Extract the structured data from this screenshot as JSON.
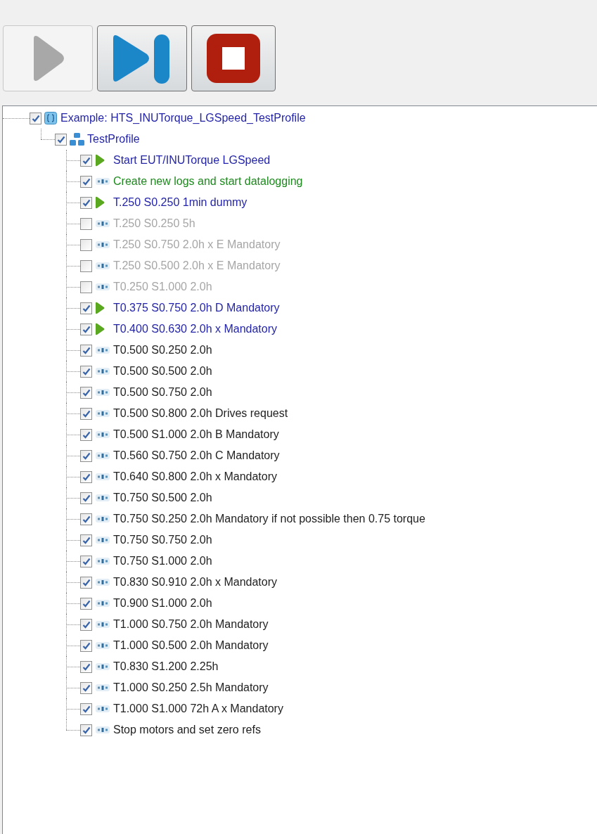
{
  "toolbar": {
    "buttons": [
      {
        "kind": "play",
        "disabled": true
      },
      {
        "kind": "step",
        "disabled": false
      },
      {
        "kind": "stop",
        "disabled": false
      }
    ]
  },
  "tree": {
    "label": "Example: HTS_INUTorque_LGSpeed_TestProfile",
    "kind": "script",
    "checked": true,
    "color": "#2424a8",
    "children": [
      {
        "label": "TestProfile",
        "kind": "profile",
        "checked": true,
        "color": "#2424a8",
        "children": [
          {
            "label": "Start EUT/INUTorque LGSpeed",
            "kind": "run",
            "checked": true,
            "color": "#2424a8"
          },
          {
            "label": "Create new logs and start datalogging",
            "kind": "step",
            "checked": true,
            "color": "#1d8a1d"
          },
          {
            "label": "T.250 S0.250 1min dummy",
            "kind": "run",
            "checked": true,
            "color": "#2424a8"
          },
          {
            "label": "T.250 S0.250 5h",
            "kind": "step",
            "checked": false,
            "color": "#a6a6a6"
          },
          {
            "label": "T.250 S0.750 2.0h x E Mandatory",
            "kind": "step",
            "checked": false,
            "color": "#a6a6a6"
          },
          {
            "label": "T.250 S0.500 2.0h x E Mandatory",
            "kind": "step",
            "checked": false,
            "color": "#a6a6a6"
          },
          {
            "label": "T0.250 S1.000 2.0h",
            "kind": "step",
            "checked": false,
            "color": "#a6a6a6"
          },
          {
            "label": "T0.375 S0.750 2.0h D Mandatory",
            "kind": "run",
            "checked": true,
            "color": "#2424a8"
          },
          {
            "label": "T0.400 S0.630 2.0h x Mandatory",
            "kind": "run",
            "checked": true,
            "color": "#2424a8"
          },
          {
            "label": "T0.500 S0.250 2.0h",
            "kind": "step",
            "checked": true,
            "color": "#222222"
          },
          {
            "label": "T0.500 S0.500 2.0h",
            "kind": "step",
            "checked": true,
            "color": "#222222"
          },
          {
            "label": "T0.500 S0.750 2.0h",
            "kind": "step",
            "checked": true,
            "color": "#222222"
          },
          {
            "label": "T0.500 S0.800 2.0h Drives request",
            "kind": "step",
            "checked": true,
            "color": "#222222"
          },
          {
            "label": "T0.500 S1.000 2.0h B Mandatory",
            "kind": "step",
            "checked": true,
            "color": "#222222"
          },
          {
            "label": "T0.560 S0.750 2.0h C Mandatory",
            "kind": "step",
            "checked": true,
            "color": "#222222"
          },
          {
            "label": "T0.640 S0.800 2.0h x Mandatory",
            "kind": "step",
            "checked": true,
            "color": "#222222"
          },
          {
            "label": "T0.750 S0.500 2.0h",
            "kind": "step",
            "checked": true,
            "color": "#222222"
          },
          {
            "label": "T0.750 S0.250 2.0h Mandatory if not possible then 0.75 torque",
            "kind": "step",
            "checked": true,
            "color": "#222222"
          },
          {
            "label": "T0.750 S0.750 2.0h",
            "kind": "step",
            "checked": true,
            "color": "#222222"
          },
          {
            "label": "T0.750 S1.000 2.0h",
            "kind": "step",
            "checked": true,
            "color": "#222222"
          },
          {
            "label": "T0.830 S0.910 2.0h x Mandatory",
            "kind": "step",
            "checked": true,
            "color": "#222222"
          },
          {
            "label": "T0.900 S1.000 2.0h",
            "kind": "step",
            "checked": true,
            "color": "#222222"
          },
          {
            "label": "T1.000 S0.750 2.0h Mandatory",
            "kind": "step",
            "checked": true,
            "color": "#222222"
          },
          {
            "label": "T1.000 S0.500 2.0h Mandatory",
            "kind": "step",
            "checked": true,
            "color": "#222222"
          },
          {
            "label": "T0.830 S1.200 2.25h",
            "kind": "step",
            "checked": true,
            "color": "#222222"
          },
          {
            "label": "T1.000 S0.250 2.5h Mandatory",
            "kind": "step",
            "checked": true,
            "color": "#222222"
          },
          {
            "label": "T1.000 S1.000 72h A x Mandatory",
            "kind": "step",
            "checked": true,
            "color": "#222222"
          },
          {
            "label": "Stop motors and set zero refs",
            "kind": "step",
            "checked": true,
            "color": "#222222"
          }
        ]
      }
    ]
  }
}
